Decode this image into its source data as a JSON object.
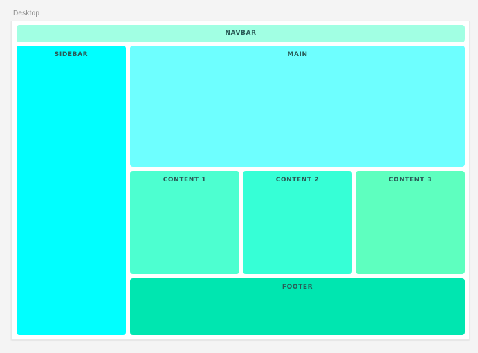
{
  "frame": {
    "label": "Desktop"
  },
  "layout": {
    "navbar": {
      "label": "NAVBAR",
      "color": "#a1ffe3"
    },
    "sidebar": {
      "label": "SIDEBAR",
      "color": "#00ffff"
    },
    "main": {
      "label": "MAIN",
      "color": "#6effff"
    },
    "content_1": {
      "label": "CONTENT 1",
      "color": "#4dffd0"
    },
    "content_2": {
      "label": "CONTENT 2",
      "color": "#36ffd6"
    },
    "content_3": {
      "label": "CONTENT 3",
      "color": "#5effbf"
    },
    "footer": {
      "label": "FOOTER",
      "color": "#00e6b0"
    }
  }
}
